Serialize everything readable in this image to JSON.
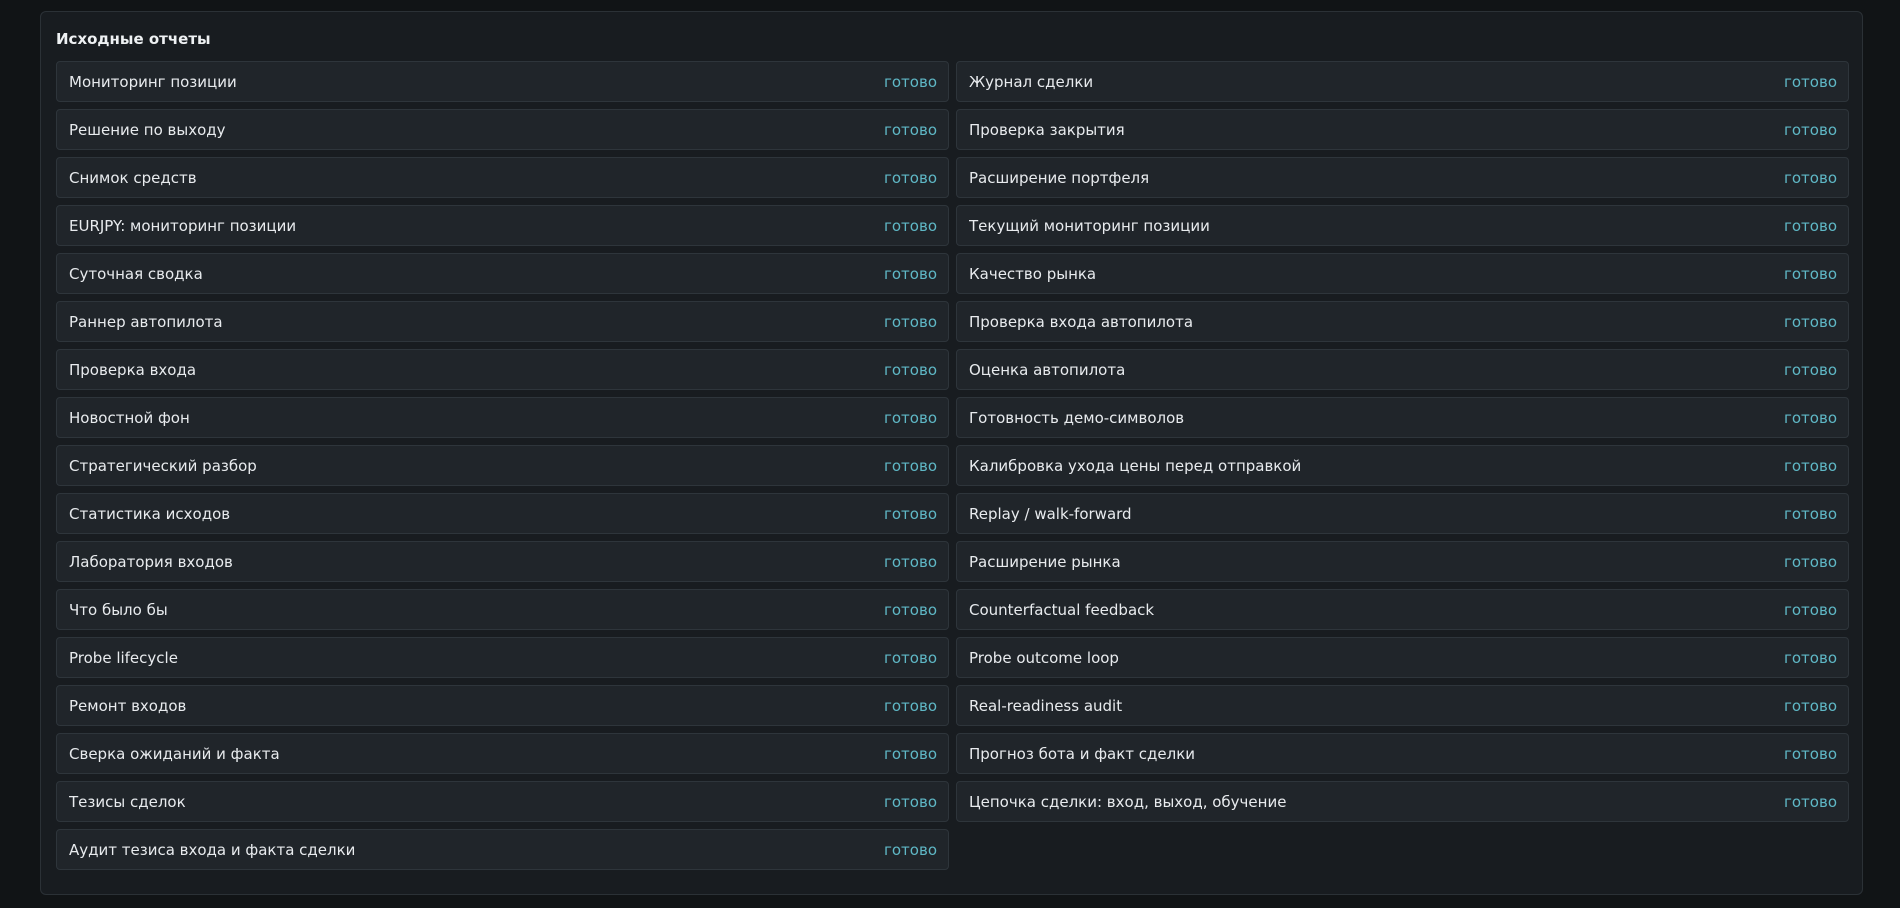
{
  "panel": {
    "title": "Исходные отчеты"
  },
  "colors": {
    "background": "#111416",
    "panel": "#181c20",
    "row": "#20252a",
    "status": "#5fb8c6"
  },
  "reports": [
    {
      "name": "Мониторинг позиции",
      "status": "готово"
    },
    {
      "name": "Журнал сделки",
      "status": "готово"
    },
    {
      "name": "Решение по выходу",
      "status": "готово"
    },
    {
      "name": "Проверка закрытия",
      "status": "готово"
    },
    {
      "name": "Снимок средств",
      "status": "готово"
    },
    {
      "name": "Расширение портфеля",
      "status": "готово"
    },
    {
      "name": "EURJPY: мониторинг позиции",
      "status": "готово"
    },
    {
      "name": "Текущий мониторинг позиции",
      "status": "готово"
    },
    {
      "name": "Суточная сводка",
      "status": "готово"
    },
    {
      "name": "Качество рынка",
      "status": "готово"
    },
    {
      "name": "Раннер автопилота",
      "status": "готово"
    },
    {
      "name": "Проверка входа автопилота",
      "status": "готово"
    },
    {
      "name": "Проверка входа",
      "status": "готово"
    },
    {
      "name": "Оценка автопилота",
      "status": "готово"
    },
    {
      "name": "Новостной фон",
      "status": "готово"
    },
    {
      "name": "Готовность демо-символов",
      "status": "готово"
    },
    {
      "name": "Стратегический разбор",
      "status": "готово"
    },
    {
      "name": "Калибровка ухода цены перед отправкой",
      "status": "готово"
    },
    {
      "name": "Статистика исходов",
      "status": "готово"
    },
    {
      "name": "Replay / walk-forward",
      "status": "готово"
    },
    {
      "name": "Лаборатория входов",
      "status": "готово"
    },
    {
      "name": "Расширение рынка",
      "status": "готово"
    },
    {
      "name": "Что было бы",
      "status": "готово"
    },
    {
      "name": "Counterfactual feedback",
      "status": "готово"
    },
    {
      "name": "Probe lifecycle",
      "status": "готово"
    },
    {
      "name": "Probe outcome loop",
      "status": "готово"
    },
    {
      "name": "Ремонт входов",
      "status": "готово"
    },
    {
      "name": "Real-readiness audit",
      "status": "готово"
    },
    {
      "name": "Сверка ожиданий и факта",
      "status": "готово"
    },
    {
      "name": "Прогноз бота и факт сделки",
      "status": "готово"
    },
    {
      "name": "Тезисы сделок",
      "status": "готово"
    },
    {
      "name": "Цепочка сделки: вход, выход, обучение",
      "status": "готово"
    },
    {
      "name": "Аудит тезиса входа и факта сделки",
      "status": "готово"
    }
  ]
}
